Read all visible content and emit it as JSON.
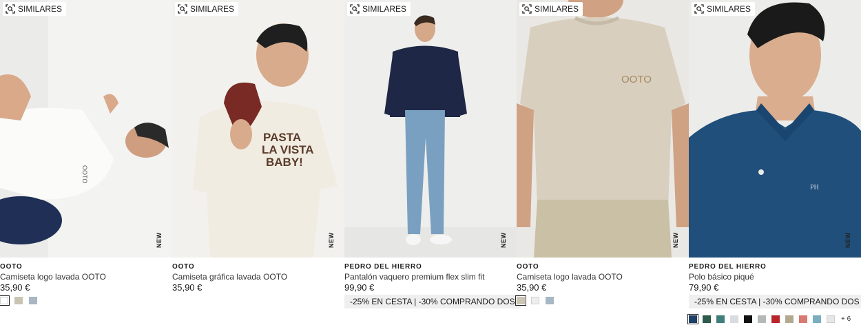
{
  "ui": {
    "similar_label": "SIMILARES",
    "new_badge": "NEW"
  },
  "products": [
    {
      "brand": "OOTO",
      "name": "Camiseta logo lavada OOTO",
      "price": "35,90 €",
      "promo": "",
      "swatches": [
        "#ffffff",
        "#c9c4b2",
        "#a7b7c3"
      ],
      "selected_swatch": 0,
      "more_colors": ""
    },
    {
      "brand": "OOTO",
      "name": "Camiseta gráfica lavada OOTO",
      "price": "35,90 €",
      "promo": "",
      "swatches": [],
      "selected_swatch": -1,
      "more_colors": ""
    },
    {
      "brand": "PEDRO DEL HIERRO",
      "name": "Pantalón vaquero premium flex slim fit",
      "price": "99,90 €",
      "promo": "-25% EN CESTA | -30% COMPRANDO DOS",
      "swatches": [],
      "selected_swatch": -1,
      "more_colors": ""
    },
    {
      "brand": "OOTO",
      "name": "Camiseta logo lavada OOTO",
      "price": "35,90 €",
      "promo": "",
      "swatches": [
        "#cbc5b3",
        "#eeeeee",
        "#a7b7c3"
      ],
      "selected_swatch": 0,
      "more_colors": ""
    },
    {
      "brand": "PEDRO DEL HIERRO",
      "name": "Polo básico piqué",
      "price": "79,90 €",
      "promo": "-25% EN CESTA | -30% COMPRANDO DOS",
      "swatches": [
        "#1f3f66",
        "#2d5a4a",
        "#3f7f7a",
        "#d9dde0",
        "#111111",
        "#b5b8b8",
        "#b8262c",
        "#b3a98f",
        "#d87a73",
        "#79aebf",
        "#e6e6e6"
      ],
      "selected_swatch": 0,
      "more_colors": "+ 6"
    }
  ]
}
